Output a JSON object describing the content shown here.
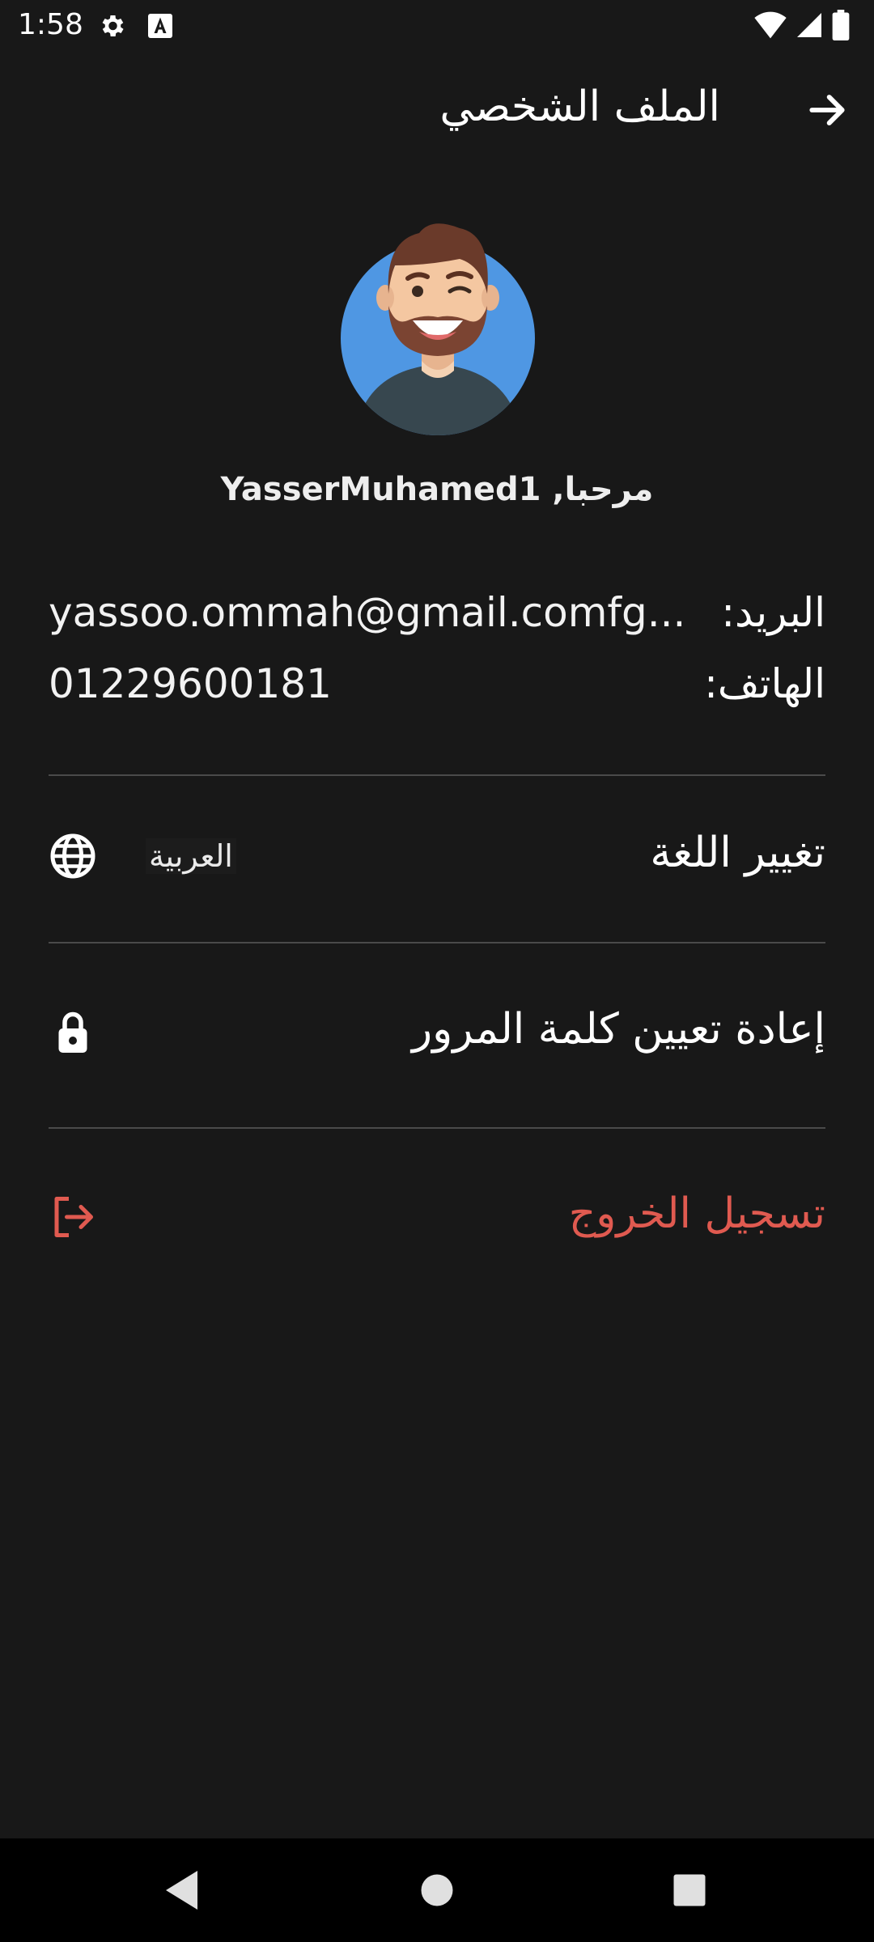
{
  "status_bar": {
    "time": "1:58",
    "icons": [
      "settings-icon",
      "font-a-icon",
      "wifi-icon",
      "signal-icon",
      "battery-icon"
    ]
  },
  "app_bar": {
    "title": "الملف الشخصي",
    "back_icon": "arrow-right-icon"
  },
  "profile": {
    "avatar": "male-avatar-winking",
    "greeting": "YasserMuhamed1 ,مرحبا"
  },
  "info": {
    "email_label": "البريد:",
    "email_value": "yassoo.ommah@gmail.comfg...",
    "phone_label": "الهاتف:",
    "phone_value": "01229600181"
  },
  "menu": {
    "change_language_label": "تغيير اللغة",
    "current_language": "العربية",
    "language_icon": "globe-icon",
    "reset_password_label": "إعادة تعيين كلمة المرور",
    "reset_password_icon": "lock-icon",
    "logout_label": "تسجيل الخروج",
    "logout_icon": "logout-icon"
  },
  "nav_bar": {
    "buttons": [
      "back-triangle-icon",
      "home-circle-icon",
      "recents-square-icon"
    ]
  },
  "colors": {
    "background": "#181818",
    "text": "#ffffff",
    "divider": "#4a4a4a",
    "logout": "#e05a50",
    "avatar_bg": "#4f97e3"
  }
}
